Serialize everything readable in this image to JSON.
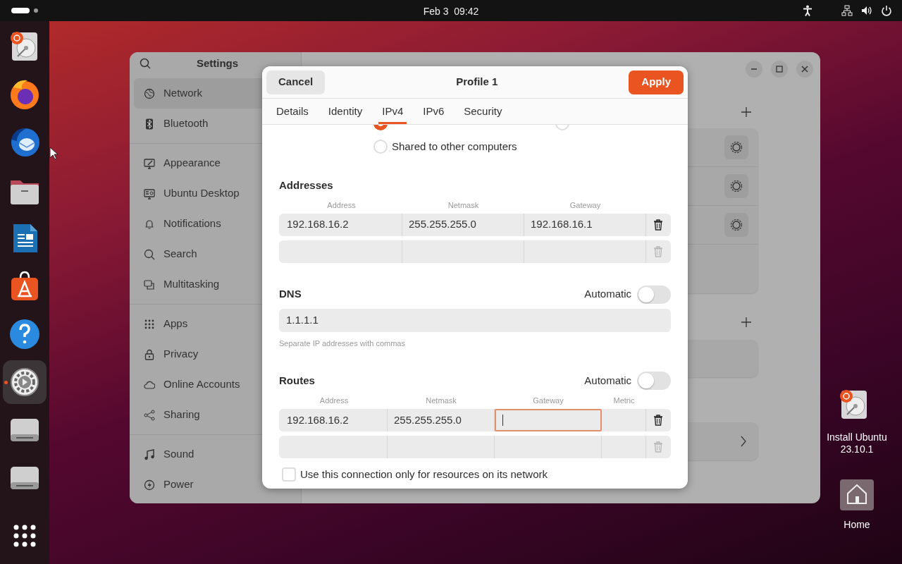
{
  "top_bar": {
    "clock": "Feb 3  09:42"
  },
  "dock": [
    {
      "kind": "installer",
      "running": false
    },
    {
      "kind": "browser",
      "running": false
    },
    {
      "kind": "mail",
      "running": false
    },
    {
      "kind": "files",
      "running": false
    },
    {
      "kind": "writer",
      "running": false
    },
    {
      "kind": "store",
      "running": false
    },
    {
      "kind": "help",
      "running": false
    },
    {
      "kind": "settings",
      "running": true
    },
    {
      "kind": "drive",
      "running": false
    },
    {
      "kind": "drive",
      "running": false
    },
    {
      "kind": "apps",
      "running": false
    }
  ],
  "desktop_icons": [
    {
      "kind": "installer",
      "label": "Install Ubuntu 23.10.1"
    },
    {
      "kind": "home",
      "label": "Home"
    }
  ],
  "settings_window": {
    "title": "Settings",
    "sidebar_groups": [
      [
        {
          "kind": "network",
          "label": "Network",
          "selected": true
        },
        {
          "kind": "bluetooth",
          "label": "Bluetooth",
          "selected": false
        }
      ],
      [
        {
          "kind": "appearance",
          "label": "Appearance",
          "selected": false
        },
        {
          "kind": "desktop",
          "label": "Ubuntu Desktop",
          "selected": false
        },
        {
          "kind": "bell",
          "label": "Notifications",
          "selected": false
        },
        {
          "kind": "search",
          "label": "Search",
          "selected": false
        },
        {
          "kind": "multitasking",
          "label": "Multitasking",
          "selected": false
        }
      ],
      [
        {
          "kind": "apps",
          "label": "Apps",
          "selected": false
        },
        {
          "kind": "lock",
          "label": "Privacy",
          "selected": false
        },
        {
          "kind": "cloud",
          "label": "Online Accounts",
          "selected": false
        },
        {
          "kind": "share",
          "label": "Sharing",
          "selected": false
        }
      ],
      [
        {
          "kind": "music",
          "label": "Sound",
          "selected": false
        },
        {
          "kind": "power",
          "label": "Power",
          "selected": false
        }
      ]
    ]
  },
  "dialog": {
    "cancel": "Cancel",
    "title": "Profile 1",
    "apply": "Apply",
    "tabs": [
      {
        "label": "Details",
        "selected": false
      },
      {
        "label": "Identity",
        "selected": false
      },
      {
        "label": "IPv4",
        "selected": true
      },
      {
        "label": "IPv6",
        "selected": false
      },
      {
        "label": "Security",
        "selected": false
      }
    ],
    "method_radios": [
      {
        "selected": true
      },
      {
        "selected": false
      },
      {
        "label": "Shared to other computers",
        "selected": false
      }
    ],
    "addresses": {
      "heading": "Addresses",
      "columns": [
        "Address",
        "Netmask",
        "Gateway"
      ],
      "rows": [
        {
          "cells": [
            {
              "value": "192.168.16.2",
              "focused": false
            },
            {
              "value": "255.255.255.0",
              "focused": false
            },
            {
              "value": "192.168.16.1",
              "focused": false
            }
          ],
          "delete_disabled": false
        },
        {
          "cells": [
            {
              "focused": false
            },
            {
              "focused": false
            },
            {
              "focused": false
            }
          ],
          "delete_disabled": true
        }
      ]
    },
    "dns": {
      "heading": "DNS",
      "automatic_label": "Automatic",
      "automatic_on": false,
      "value": "1.1.1.1",
      "hint": "Separate IP addresses with commas"
    },
    "routes": {
      "heading": "Routes",
      "automatic_label": "Automatic",
      "automatic_on": false,
      "columns": [
        "Address",
        "Netmask",
        "Gateway",
        "Metric"
      ],
      "rows": [
        {
          "cells": [
            {
              "value": "192.168.16.2",
              "focused": false
            },
            {
              "value": "255.255.255.0",
              "focused": false
            },
            {
              "focused": true
            },
            {
              "focused": false
            }
          ],
          "delete_disabled": false
        },
        {
          "cells": [
            {
              "focused": false
            },
            {
              "focused": false
            },
            {
              "focused": false
            },
            {
              "focused": false
            }
          ],
          "delete_disabled": true
        }
      ]
    },
    "local_only": {
      "label": "Use this connection only for resources on its network",
      "checked": false
    }
  }
}
